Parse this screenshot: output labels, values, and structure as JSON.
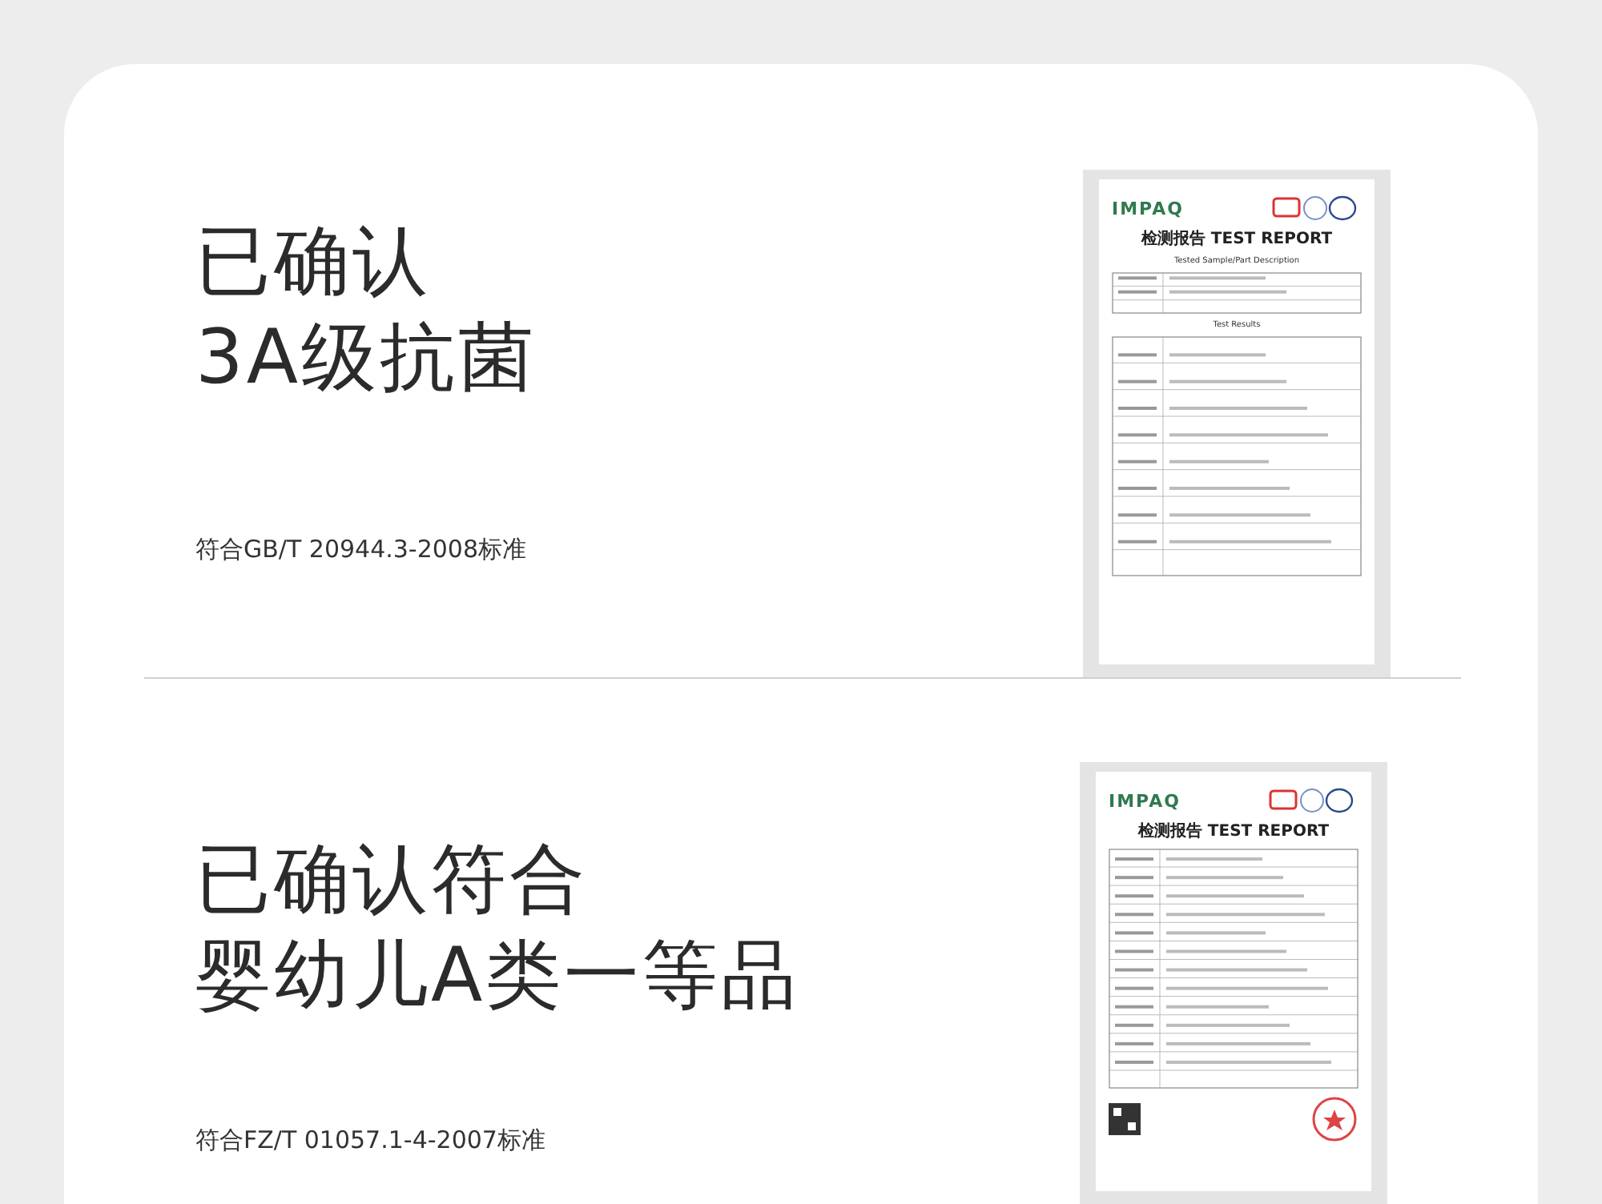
{
  "sections": [
    {
      "heading_lines": [
        "已确认",
        "3A级抗菌"
      ],
      "caption": "符合GB/T 20944.3-2008标准",
      "document": {
        "kind": "results",
        "logo": "IMPAQ",
        "title": "检测报告 TEST REPORT",
        "subtitles": [
          "Tested Sample/Part Description",
          "Test Results"
        ]
      }
    },
    {
      "heading_lines": [
        "已确认符合",
        "婴幼儿A类一等品"
      ],
      "caption": "符合FZ/T 01057.1-4-2007标准",
      "document": {
        "kind": "information",
        "logo": "IMPAQ",
        "title": "检测报告 TEST REPORT"
      }
    }
  ]
}
